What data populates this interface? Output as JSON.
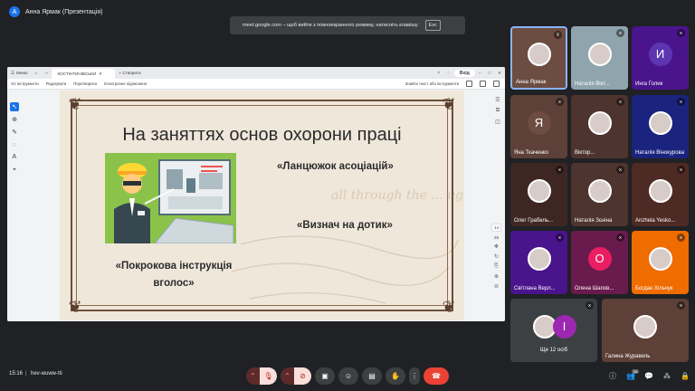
{
  "presenter": {
    "avatar_letter": "А",
    "label": "Анна Ярмак (Презентація)"
  },
  "fullscreen_toast": {
    "text": "meet.google.com – щоб вийти з повноекранного режиму, натисніть клавішу",
    "key": "Esc"
  },
  "shared_window": {
    "tabbar": {
      "menu_label": "Меню",
      "tab_title": "КОСТІНТИНІВСЬКИ",
      "new_button_label": "+ Створити",
      "login_label": "Вхід"
    },
    "menubar": {
      "items": [
        "Усі інструменти",
        "Редагувати",
        "Перетворити",
        "Електронне підписання"
      ],
      "search_placeholder": "Знайти текст або інструменти"
    },
    "left_tools": [
      "↖",
      "⊕",
      "✎",
      "◌",
      "Ꭺ",
      "⌖"
    ],
    "right_tools": [
      "☰",
      "⧉",
      "◫"
    ],
    "page": {
      "current": "14",
      "total": "25"
    },
    "bottom_tools": [
      "↻",
      "⎘",
      "⊕",
      "⊖"
    ]
  },
  "slide": {
    "title": "На заняттях основ охорони праці",
    "text1": "«Ланцюжок асоціацій»",
    "text2": "«Визнач на дотик»",
    "text3": "«Покрокова інструкція вголос»",
    "handwriting": "all through the ... ught kind ... Valley there is a"
  },
  "participants": [
    {
      "name": "Анна Ярмак",
      "bg": "#6d4c41",
      "type": "photo",
      "active": true
    },
    {
      "name": "Наталія Вікт...",
      "bg": "#90a4ae",
      "type": "photo",
      "active": false
    },
    {
      "name": "Инга Голик",
      "bg": "#4a148c",
      "type": "letter",
      "letter": "И",
      "circle": "#5e35b1",
      "active": false
    },
    {
      "name": "Яна Ткаченко",
      "bg": "#5d4037",
      "type": "letter",
      "letter": "Я",
      "circle": "#6d4c41",
      "active": false
    },
    {
      "name": "Віктор...",
      "bg": "#4e342e",
      "type": "photo",
      "active": false
    },
    {
      "name": "Наталія Вінокурова",
      "bg": "#1a237e",
      "type": "photo",
      "active": false
    },
    {
      "name": "Олег Грабель...",
      "bg": "#3e2723",
      "type": "photo",
      "active": false
    },
    {
      "name": "Наталія Зєніна",
      "bg": "#4e342e",
      "type": "photo",
      "active": false
    },
    {
      "name": "Anzhela Yesko...",
      "bg": "#4e2a24",
      "type": "photo",
      "active": false
    },
    {
      "name": "Світлана Верл...",
      "bg": "#4a148c",
      "type": "photo",
      "active": false
    },
    {
      "name": "Олена Шапов...",
      "bg": "#6a1b4d",
      "type": "letter",
      "letter": "О",
      "circle": "#e91e63",
      "active": false
    },
    {
      "name": "Богдан Хільчук",
      "bg": "#ef6c00",
      "type": "photo",
      "active": false
    },
    {
      "name": "Ще 12 осіб",
      "bg": "#3c4043",
      "type": "more",
      "letter": "I",
      "active": false
    },
    {
      "name": "Галина Журавель",
      "bg": "#5d4037",
      "type": "photo",
      "active": false
    }
  ],
  "bottom_bar": {
    "time": "15:16",
    "separator": "|",
    "meeting_code": "hev-wuww-tti",
    "people_count": "26",
    "controls": [
      "mic-toggle",
      "camera-toggle",
      "present",
      "emoji",
      "captions",
      "raise-hand",
      "more",
      "leave"
    ],
    "right_icons": [
      "info",
      "people",
      "chat",
      "activities",
      "host-controls"
    ]
  },
  "colors": {
    "leave": "#ea4335",
    "mic_off": "#f28b82",
    "control_bg": "#3c4043",
    "accent": "#8ab4f8"
  }
}
